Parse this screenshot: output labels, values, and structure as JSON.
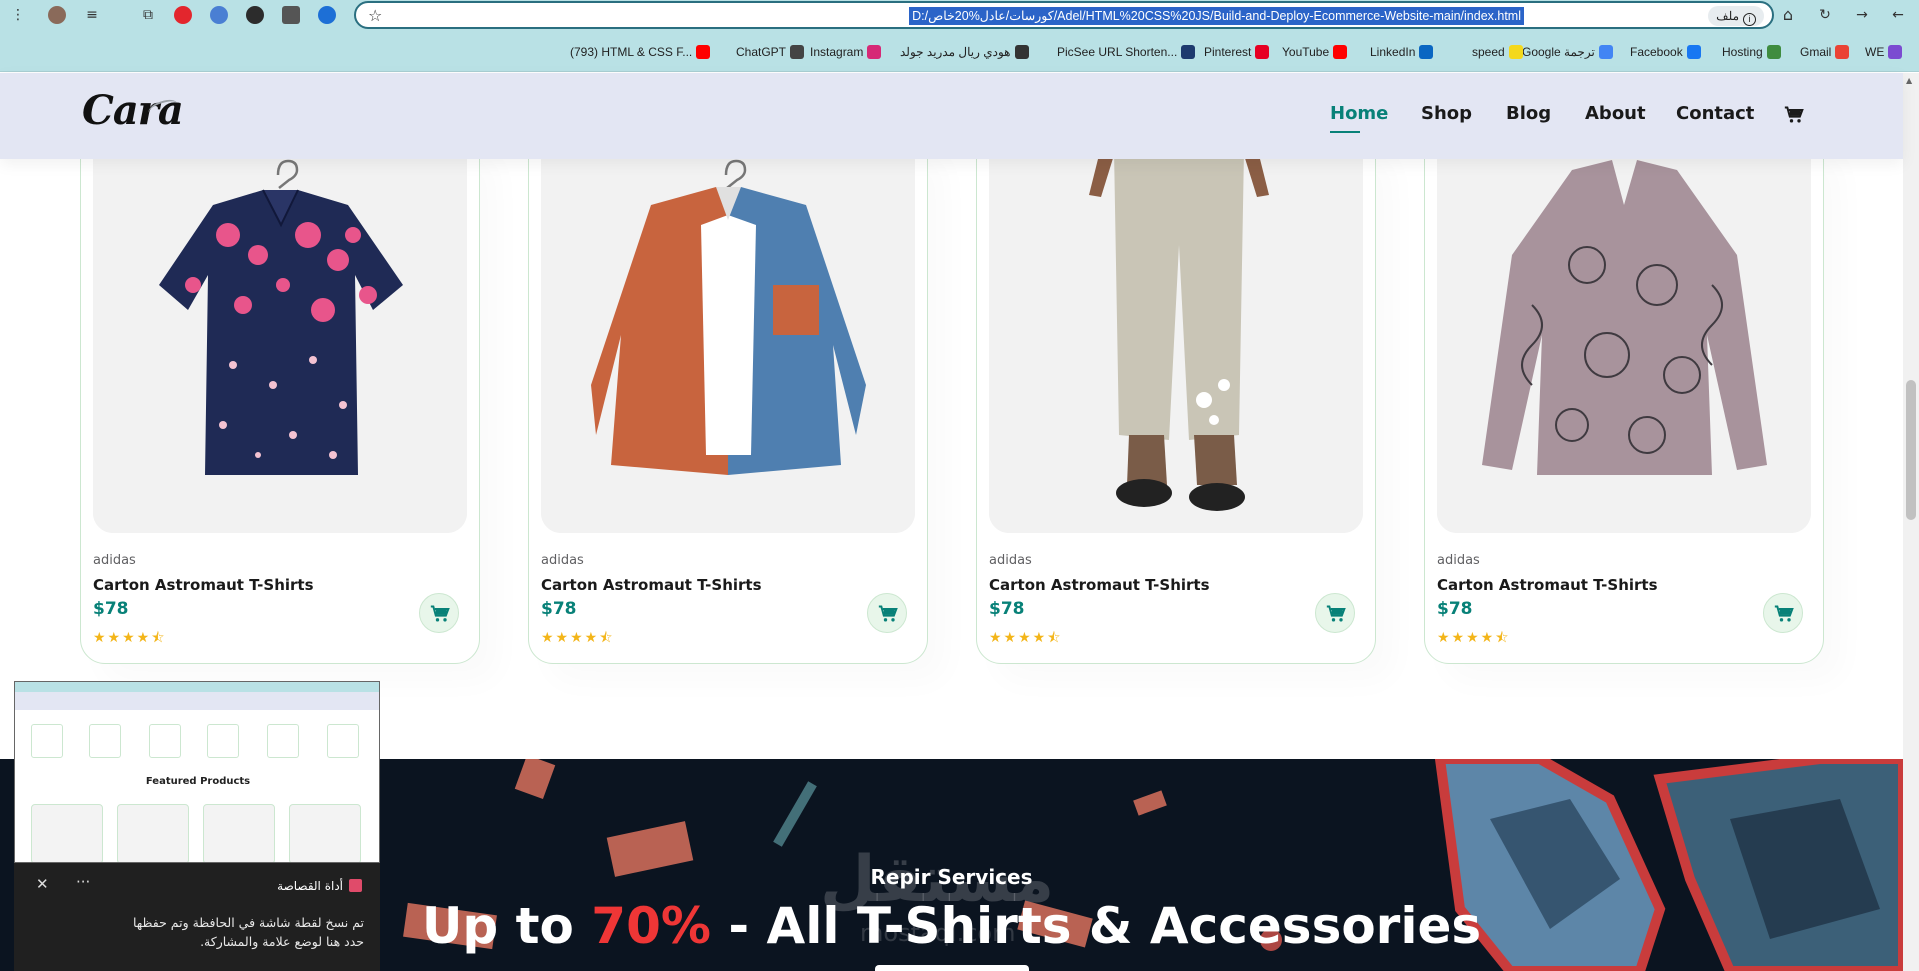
{
  "browser": {
    "url": "D:/كورسات/عادل%20خاص/Adel/HTML%20CSS%20JS/Build-and-Deploy-Ecommerce-Website-main/index.html",
    "site_info_label": "ملف",
    "bookmarks": [
      {
        "label": "WE",
        "color": "#7b4bd1"
      },
      {
        "label": "Gmail",
        "color": "#ea4335"
      },
      {
        "label": "Hosting",
        "color": "#3f8c3f"
      },
      {
        "label": "Facebook",
        "color": "#1877f2"
      },
      {
        "label": "Google ترجمة",
        "color": "#4285f4"
      },
      {
        "label": "speed",
        "color": "#f4d81c"
      },
      {
        "label": "LinkedIn",
        "color": "#0a66c2"
      },
      {
        "label": "YouTube",
        "color": "#ff0000"
      },
      {
        "label": "Pinterest",
        "color": "#e60023"
      },
      {
        "label": "PicSee URL Shorten...",
        "color": "#1d3a6e"
      },
      {
        "label": "هودي ريال مدريد جولد",
        "color": "#333333"
      },
      {
        "label": "Instagram",
        "color": "#d62976"
      },
      {
        "label": "ChatGPT",
        "color": "#444444"
      },
      {
        "label": "(793) HTML & CSS F...",
        "color": "#ff0000"
      }
    ]
  },
  "site": {
    "logo": "Cara",
    "nav": [
      "Home",
      "Shop",
      "Blog",
      "About",
      "Contact"
    ],
    "active_nav": "Home",
    "accent": "#088178"
  },
  "products": [
    {
      "brand": "adidas",
      "name": "Carton Astromaut T-Shirts",
      "price": "$78",
      "rating": 4.5,
      "stars": "★★★★⯪",
      "image": "floral-navy-shirt"
    },
    {
      "brand": "adidas",
      "name": "Carton Astromaut T-Shirts",
      "price": "$78",
      "rating": 4.5,
      "stars": "★★★★⯪",
      "image": "orange-blue-corduroy-shirt"
    },
    {
      "brand": "adidas",
      "name": "Carton Astromaut T-Shirts",
      "price": "$78",
      "rating": 4.5,
      "stars": "★★★★⯪",
      "image": "linen-floral-pants"
    },
    {
      "brand": "adidas",
      "name": "Carton Astromaut T-Shirts",
      "price": "$78",
      "rating": 4.5,
      "stars": "★★★★⯪",
      "image": "cat-print-blouse"
    }
  ],
  "banner": {
    "subtitle": "Repir Services",
    "title_before": "Up to ",
    "title_highlight": "70%",
    "title_after": " - All T-Shirts & Accessories",
    "highlight_color": "#ef3636",
    "watermark": "مستقل",
    "watermark_sub": "mostaql.com"
  },
  "snip_tool": {
    "title": "أداة القصاصة",
    "message_line1": "تم نسخ لقطة شاشة في الحافظة وتم حفظها",
    "message_line2": "حدد هنا لوضع علامة والمشاركة.",
    "thumb_heading": "Featured Products"
  }
}
